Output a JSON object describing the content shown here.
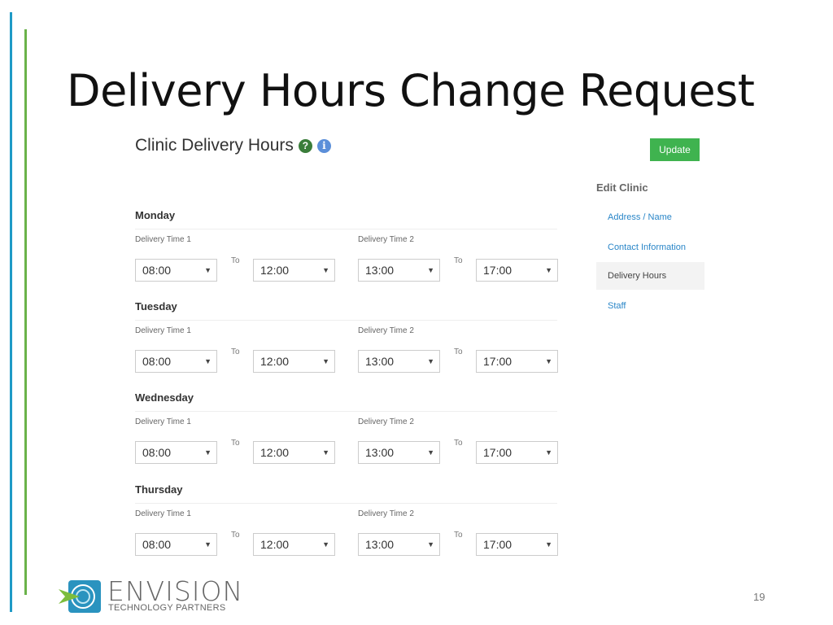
{
  "slide": {
    "title": "Delivery Hours Change Request",
    "page_number": "19",
    "accent_colors": {
      "blue": "#1f9ac6",
      "green": "#6ab24a"
    }
  },
  "panel": {
    "title": "Clinic Delivery Hours",
    "help_icon": "question-circle-icon",
    "info_icon": "info-circle-icon",
    "update_label": "Update",
    "update_color": "#3fb34f"
  },
  "sidebar": {
    "heading": "Edit Clinic",
    "items": [
      {
        "label": "Address / Name",
        "active": false
      },
      {
        "label": "Contact Information",
        "active": false
      },
      {
        "label": "Delivery Hours",
        "active": true
      },
      {
        "label": "Staff",
        "active": false
      }
    ]
  },
  "labels": {
    "time1": "Delivery Time 1",
    "time2": "Delivery Time 2",
    "to": "To"
  },
  "days": [
    {
      "name": "Monday",
      "t1_from": "08:00",
      "t1_to": "12:00",
      "t2_from": "13:00",
      "t2_to": "17:00"
    },
    {
      "name": "Tuesday",
      "t1_from": "08:00",
      "t1_to": "12:00",
      "t2_from": "13:00",
      "t2_to": "17:00"
    },
    {
      "name": "Wednesday",
      "t1_from": "08:00",
      "t1_to": "12:00",
      "t2_from": "13:00",
      "t2_to": "17:00"
    },
    {
      "name": "Thursday",
      "t1_from": "08:00",
      "t1_to": "12:00",
      "t2_from": "13:00",
      "t2_to": "17:00"
    }
  ],
  "logo": {
    "word": "ENVISION",
    "subtitle": "TECHNOLOGY PARTNERS"
  }
}
